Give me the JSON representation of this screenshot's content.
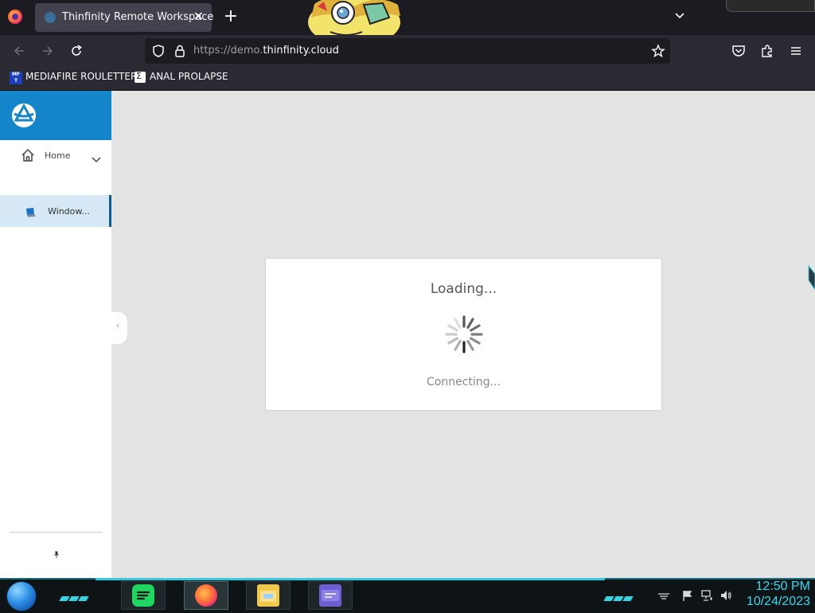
{
  "browser": {
    "tab": {
      "title": "Thinfinity Remote Workspace",
      "close": "✕"
    },
    "new_tab": "+",
    "url": {
      "scheme": "https://",
      "subdomain": "demo.",
      "domain": "thinfinity.cloud"
    },
    "bookmarks": [
      {
        "label": "MEDIAFIRE ROULETTER",
        "icon_text": "MF T"
      },
      {
        "label": "ANAL PROLAPSE"
      }
    ]
  },
  "sidebar": {
    "home_label": "Home",
    "items": [
      {
        "label": "Window..."
      }
    ],
    "accent_color": "#1485c8"
  },
  "dialog": {
    "title": "Loading...",
    "status": "Connecting..."
  },
  "taskbar": {
    "apps": [
      "spotify",
      "firefox",
      "file-explorer",
      "card-app"
    ],
    "clock": {
      "time": "12:50 PM",
      "date": "10/24/2023"
    }
  }
}
